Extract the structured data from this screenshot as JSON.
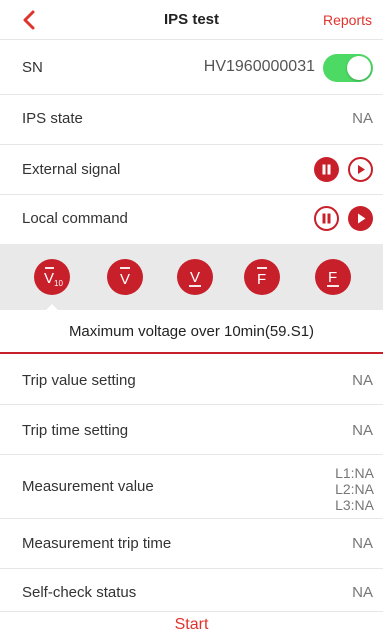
{
  "header": {
    "title": "IPS test",
    "reports_label": "Reports",
    "back_icon": "chevron-left-icon",
    "accent_color": "#e0332c"
  },
  "sn_row": {
    "label": "SN",
    "value": "HV1960000031",
    "toggle_on": true
  },
  "ips_state": {
    "label": "IPS state",
    "value": "NA"
  },
  "external_signal": {
    "label": "External signal",
    "pause_icon": "pause-icon",
    "play_icon": "play-icon"
  },
  "local_command": {
    "label": "Local command",
    "pause_icon": "pause-icon",
    "play_icon": "play-icon"
  },
  "mode_buttons": [
    {
      "name": "voltage-10min-average",
      "main": "V",
      "sub": "10",
      "mark": "overline"
    },
    {
      "name": "voltage-overline",
      "main": "V",
      "sub": "",
      "mark": "overline"
    },
    {
      "name": "voltage-underline",
      "main": "V",
      "sub": "",
      "mark": "underline"
    },
    {
      "name": "frequency-overline",
      "main": "F",
      "sub": "",
      "mark": "overline"
    },
    {
      "name": "frequency-underline",
      "main": "F",
      "sub": "",
      "mark": "underline"
    }
  ],
  "selected_mode_title": "Maximum voltage over 10min(59.S1)",
  "details": {
    "trip_value": {
      "label": "Trip value setting",
      "value": "NA"
    },
    "trip_time": {
      "label": "Trip time setting",
      "value": "NA"
    },
    "measurement_value": {
      "label": "Measurement value",
      "l1": "L1:NA",
      "l2": "L2:NA",
      "l3": "L3:NA"
    },
    "measurement_trip_time": {
      "label": "Measurement trip time",
      "value": "NA"
    },
    "self_check": {
      "label": "Self-check status",
      "value": "NA"
    }
  },
  "footer": {
    "start_label": "Start"
  },
  "colors": {
    "primary_red": "#c8202a",
    "toggle_green": "#4cd964",
    "band_gray": "#e9e9e9"
  }
}
